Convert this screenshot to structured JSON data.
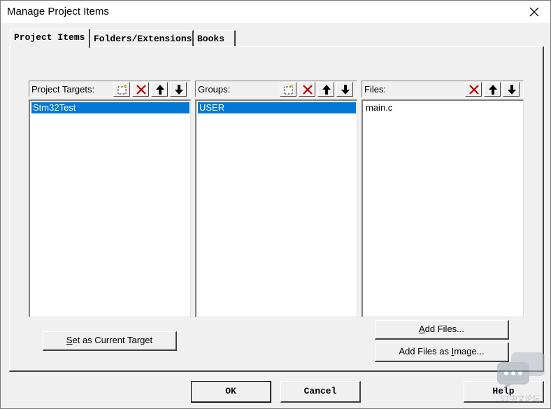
{
  "window": {
    "title": "Manage Project Items"
  },
  "tabs": [
    {
      "label": "Project Items",
      "active": true
    },
    {
      "label": "Folders/Extensions",
      "active": false
    },
    {
      "label": "Books",
      "active": false
    }
  ],
  "panels": {
    "targets": {
      "label": "Project Targets:",
      "items": [
        {
          "text": "Stm32Test",
          "selected": true
        }
      ]
    },
    "groups": {
      "label": "Groups:",
      "items": [
        {
          "text": "USER",
          "selected": true
        }
      ]
    },
    "files": {
      "label": "Files:",
      "items": [
        {
          "text": "main.c",
          "selected": false
        }
      ]
    }
  },
  "icons": {
    "new": "new-item-icon",
    "delete": "delete-x-icon",
    "up": "move-up-arrow-icon",
    "down": "move-down-arrow-icon",
    "close": "close-icon"
  },
  "buttons": {
    "set_current_target": {
      "pre": "",
      "u": "S",
      "post": "et as Current Target"
    },
    "add_files": {
      "pre": "",
      "u": "A",
      "post": "dd Files..."
    },
    "add_files_image": {
      "pre": "Add Files as ",
      "u": "I",
      "post": "mage..."
    },
    "ok": "OK",
    "cancel": "Cancel",
    "help": "Help"
  },
  "watermark": {
    "text": "ST中文论坛"
  },
  "colors": {
    "selection": "#0078d7",
    "delete_red": "#c00000",
    "dialog_bg": "#f0f0f0"
  }
}
